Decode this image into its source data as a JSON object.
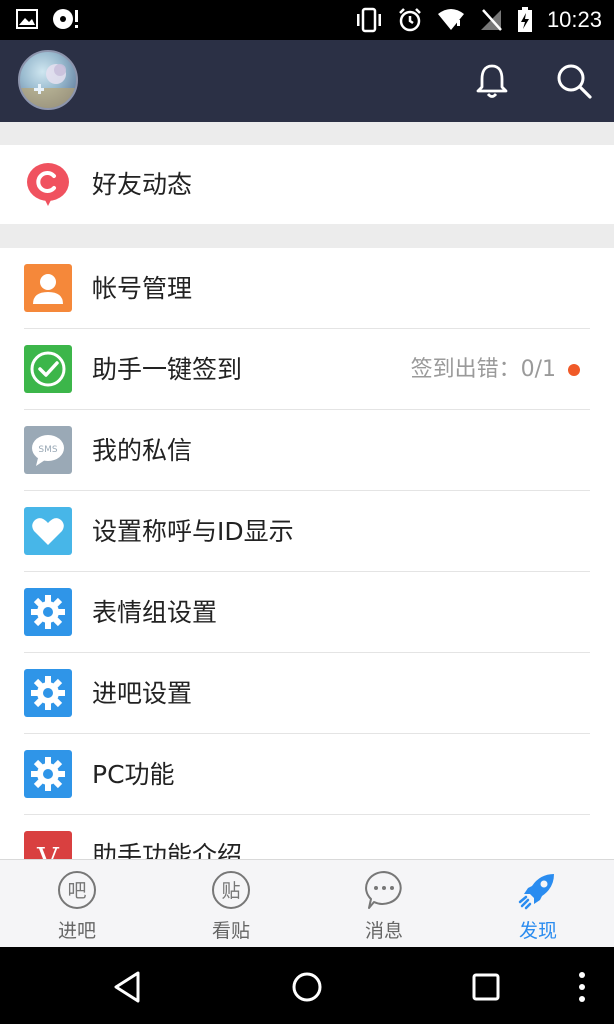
{
  "status_bar": {
    "time": "10:23"
  },
  "header": {
    "avatar": "avatar",
    "icons": [
      "bell-icon",
      "search-icon"
    ]
  },
  "friends_group": {
    "items": [
      {
        "label": "好友动态",
        "icon": "friends-feed-icon",
        "color": "#f0525f"
      }
    ]
  },
  "settings_group": {
    "items": [
      {
        "label": "帐号管理",
        "icon": "person-icon",
        "color": "#f5883a"
      },
      {
        "label": "助手一键签到",
        "icon": "check-icon",
        "color": "#3cb64a",
        "status": "签到出错：0/1",
        "dot_color": "#f05a28"
      },
      {
        "label": "我的私信",
        "icon": "sms-icon",
        "color": "#9aa9b6"
      },
      {
        "label": "设置称呼与ID显示",
        "icon": "heart-icon",
        "color": "#47b6e8"
      },
      {
        "label": "表情组设置",
        "icon": "gear-icon",
        "color": "#2f95e8"
      },
      {
        "label": "进吧设置",
        "icon": "gear-icon",
        "color": "#2f95e8"
      },
      {
        "label": "PC功能",
        "icon": "gear-icon",
        "color": "#2f95e8"
      },
      {
        "label": "助手功能介绍",
        "icon": "v-icon",
        "color": "#d94040"
      }
    ]
  },
  "tabs": [
    {
      "label": "进吧",
      "glyph": "吧",
      "active": false
    },
    {
      "label": "看贴",
      "glyph": "贴",
      "active": false
    },
    {
      "label": "消息",
      "glyph": "···",
      "active": false
    },
    {
      "label": "发现",
      "glyph": "",
      "active": true
    }
  ],
  "colors": {
    "accent": "#2a8cf0",
    "header_bg": "#2b3045"
  }
}
